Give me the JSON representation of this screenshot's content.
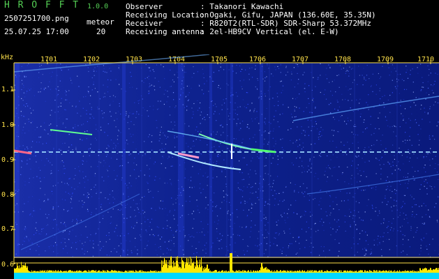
{
  "app": {
    "name": "H R O F F T",
    "version": "1.0.0",
    "filename": "2507251700.png",
    "datetime": "25.07.25 17:00",
    "meteor_label": "meteor",
    "meteor_count": "20"
  },
  "info": {
    "rows": [
      {
        "label": "Observer",
        "value": ": Takanori Kawachi"
      },
      {
        "label": "Receiving Location",
        "value": ": Ogaki, Gifu, JAPAN (136.60E, 35.35N)"
      },
      {
        "label": "Receiver",
        "value": ": R820T2(RTL-SDR) SDR-Sharp 53.372MHz"
      },
      {
        "label": "Receiving antenna",
        "value": ": 2el-HB9CV Vertical (el. E-W)"
      }
    ]
  },
  "chart_data": {
    "type": "heatmap",
    "ylabel": "kHz",
    "x_ticks": [
      "1701",
      "1702",
      "1703",
      "1704",
      "1705",
      "1706",
      "1707",
      "1708",
      "1709",
      "1710"
    ],
    "y_ticks": [
      "1.1",
      "1.0",
      "0.9",
      "0.8",
      "0.7",
      "0.6"
    ],
    "colors": {
      "background": "#0a1d8c",
      "noise": "#3c5cff",
      "axis": "#ffe24a",
      "carrier": "#8fd7ff",
      "echo": "#40ff80"
    }
  }
}
